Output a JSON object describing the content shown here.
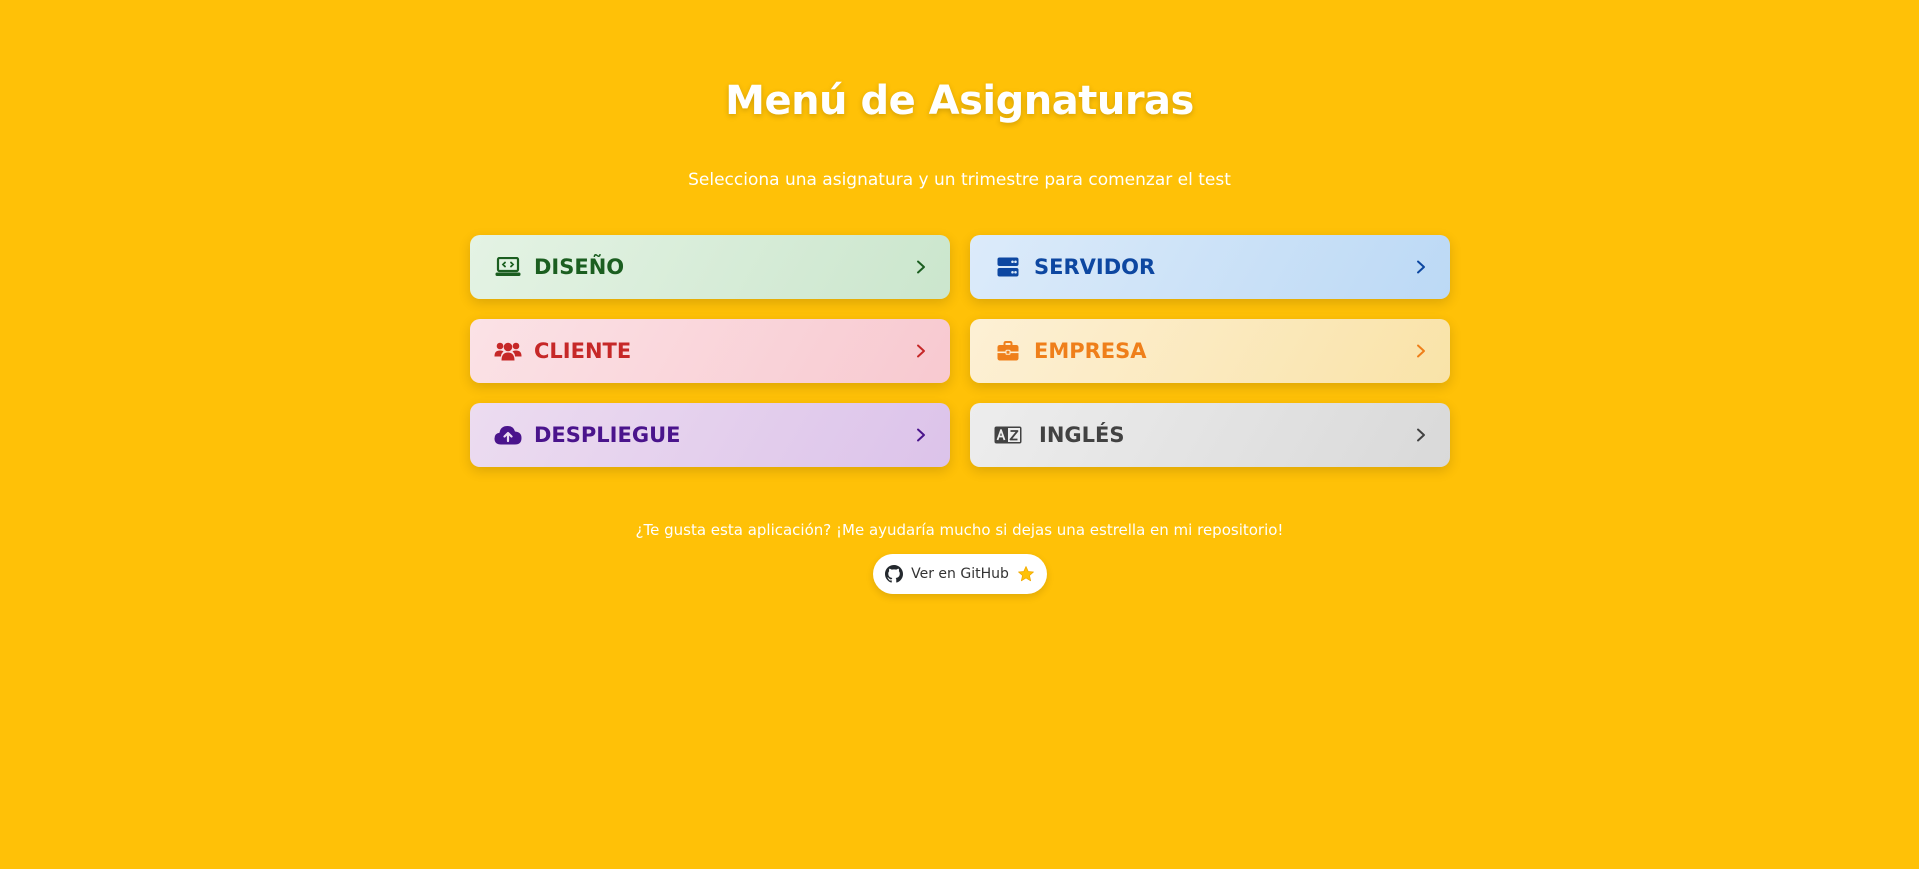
{
  "header": {
    "title": "Menú de Asignaturas",
    "subtitle": "Selecciona una asignatura y un trimestre para comenzar el test"
  },
  "subjects": [
    {
      "label": "DISEÑO",
      "icon": "laptop-code-icon",
      "color": "#1b5e20"
    },
    {
      "label": "SERVIDOR",
      "icon": "server-icon",
      "color": "#0d47a1"
    },
    {
      "label": "CLIENTE",
      "icon": "users-icon",
      "color": "#c62828"
    },
    {
      "label": "EMPRESA",
      "icon": "briefcase-icon",
      "color": "#ef7f1a"
    },
    {
      "label": "DESPLIEGUE",
      "icon": "cloud-upload-icon",
      "color": "#4a148c"
    },
    {
      "label": "INGLÉS",
      "icon": "language-icon",
      "color": "#424242"
    }
  ],
  "footer": {
    "text": "¿Te gusta esta aplicación? ¡Me ayudaría mucho si dejas una estrella en mi repositorio!",
    "button_label": "Ver en GitHub"
  },
  "colors": {
    "background": "#FFC107",
    "star": "#FFC107"
  }
}
